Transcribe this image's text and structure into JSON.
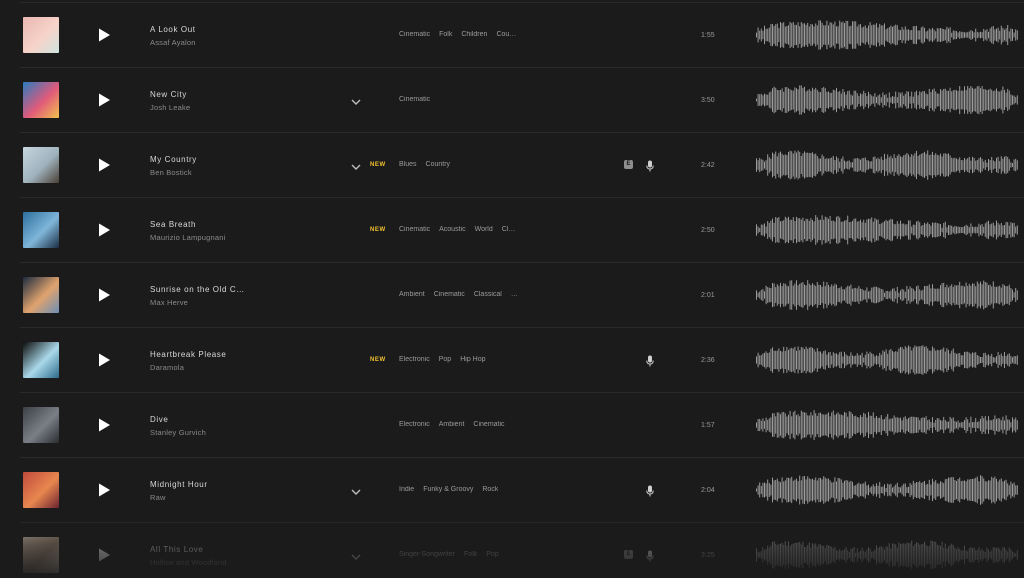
{
  "tracks": [
    {
      "title": "A Look Out",
      "artist": "Assaf Ayalon",
      "genres": [
        "Cinematic",
        "Folk",
        "Children",
        "Cou…"
      ],
      "duration": "1:55",
      "is_new": false,
      "has_chevron": false,
      "explicit": false,
      "vocals": false,
      "cover_colors": [
        "#e9b6b1",
        "#f6d3c9",
        "#cfe3dd"
      ]
    },
    {
      "title": "New City",
      "artist": "Josh Leake",
      "genres": [
        "Cinematic"
      ],
      "duration": "3:50",
      "is_new": false,
      "has_chevron": true,
      "explicit": false,
      "vocals": false,
      "cover_colors": [
        "#2a7bbf",
        "#e05a7a",
        "#f3c14e"
      ]
    },
    {
      "title": "My Country",
      "artist": "Ben Bostick",
      "genres": [
        "Blues",
        "Country"
      ],
      "duration": "2:42",
      "is_new": true,
      "has_chevron": true,
      "explicit": true,
      "vocals": true,
      "cover_colors": [
        "#c7d6df",
        "#9fb2bd",
        "#4a4036"
      ]
    },
    {
      "title": "Sea Breath",
      "artist": "Maurizio Lampugnani",
      "genres": [
        "Cinematic",
        "Acoustic",
        "World",
        "Cl…"
      ],
      "duration": "2:50",
      "is_new": true,
      "has_chevron": false,
      "explicit": false,
      "vocals": false,
      "cover_colors": [
        "#2c6f9e",
        "#7fb6d8",
        "#1b2d44"
      ]
    },
    {
      "title": "Sunrise on the Old C…",
      "artist": "Max Herve",
      "genres": [
        "Ambient",
        "Cinematic",
        "Classical",
        "…"
      ],
      "duration": "2:01",
      "is_new": false,
      "has_chevron": false,
      "explicit": false,
      "vocals": false,
      "cover_colors": [
        "#1c2a3f",
        "#e0a36e",
        "#6c8fb6"
      ]
    },
    {
      "title": "Heartbreak Please",
      "artist": "Daramola",
      "genres": [
        "Electronic",
        "Pop",
        "Hip Hop"
      ],
      "duration": "2:36",
      "is_new": true,
      "has_chevron": false,
      "explicit": false,
      "vocals": true,
      "cover_colors": [
        "#0c0c0c",
        "#a9d8ea",
        "#2d6a8a"
      ]
    },
    {
      "title": "Dive",
      "artist": "Stanley Gurvich",
      "genres": [
        "Electronic",
        "Ambient",
        "Cinematic"
      ],
      "duration": "1:57",
      "is_new": false,
      "has_chevron": false,
      "explicit": false,
      "vocals": false,
      "cover_colors": [
        "#3c4045",
        "#7a7f86",
        "#2a2d31"
      ]
    },
    {
      "title": "Midnight Hour",
      "artist": "Raw",
      "genres": [
        "Indie",
        "Funky & Groovy",
        "Rock"
      ],
      "duration": "2:04",
      "is_new": false,
      "has_chevron": true,
      "explicit": false,
      "vocals": true,
      "cover_colors": [
        "#c04a3c",
        "#e8874f",
        "#6b2330"
      ]
    },
    {
      "title": "All This Love",
      "artist": "Hollow and Woodland",
      "genres": [
        "Singer-Songwriter",
        "Folk",
        "Pop"
      ],
      "duration": "3:25",
      "is_new": false,
      "has_chevron": true,
      "explicit": true,
      "vocals": true,
      "cover_colors": [
        "#d9c5b0",
        "#a88d77",
        "#efe3d4"
      ]
    }
  ],
  "labels": {
    "new_badge": "NEW",
    "explicit_badge": "E"
  },
  "icons": {
    "play": "play-icon",
    "chevron": "chevron-down-icon",
    "mic": "microphone-icon",
    "explicit": "explicit-icon"
  },
  "colors": {
    "background": "#1b1b1b",
    "accent_new": "#f2c232",
    "waveform": "#9b9b9b"
  }
}
